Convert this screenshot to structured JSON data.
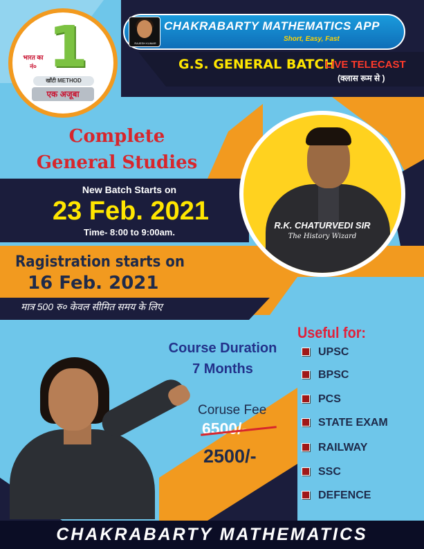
{
  "badge": {
    "rank_label": "भारत का नं०",
    "rank_number": "1",
    "method_label": "खाँटी METHOD",
    "tagline": "एक अजूबा"
  },
  "app": {
    "title": "CHAKRABARTY MATHEMATICS APP",
    "tagline": "Short, Easy, Fast",
    "logo_text": "RAJESH KUMAR"
  },
  "batch_header": {
    "title": "G.S. GENERAL BATCH",
    "live": "LIVE TELECAST",
    "note": "(क्लास रूम से )"
  },
  "course": {
    "title_line1": "Complete",
    "title_line2": "General Studies",
    "batch_label": "New Batch Starts on",
    "batch_date": "23 Feb. 2021",
    "batch_time": "Time- 8:00 to 9:00am."
  },
  "teacher": {
    "name": "R.K. CHATURVEDI SIR",
    "title": "The History Wizard"
  },
  "registration": {
    "label": "Ragistration starts on",
    "date": "16 Feb. 2021",
    "fee_note": "मात्र  500 रु० केवल सीमित समय के लिए"
  },
  "duration": {
    "line1": "Course Duration",
    "line2": "7 Months"
  },
  "fee": {
    "label": "Coruse Fee",
    "old": "6500/-",
    "new": "2500/-"
  },
  "useful_for": {
    "label": "Useful for:",
    "items": [
      "UPSC",
      "BPSC",
      "PCS",
      "STATE EXAM",
      "RAILWAY",
      "SSC",
      "DEFENCE"
    ]
  },
  "footer": {
    "text": "CHAKRABARTY MATHEMATICS"
  },
  "colors": {
    "sky": "#6ec6ea",
    "navy": "#1b1d3c",
    "orange": "#f29a1f",
    "yellow": "#ffe600",
    "red": "#d7262c"
  }
}
